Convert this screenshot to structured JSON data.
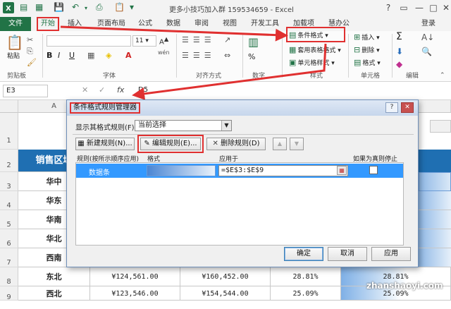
{
  "window": {
    "title": "更多小技巧加入群 159534659 - Excel",
    "user": "登录",
    "help": "?",
    "minimize": "—",
    "restore": "□",
    "close": "✕"
  },
  "ribbon_tabs": [
    "文件",
    "开始",
    "插入",
    "页面布局",
    "公式",
    "数据",
    "审阅",
    "视图",
    "开发工具",
    "加载项",
    "慧办公"
  ],
  "ribbon": {
    "clipboard": {
      "paste": "粘贴",
      "group_label": "剪贴板"
    },
    "font": {
      "font_name": "",
      "font_size": "11",
      "bold": "B",
      "italic": "I",
      "underline": "U",
      "group_label": "字体",
      "wen": "wén"
    },
    "alignment": {
      "group_label": "对齐方式"
    },
    "number": {
      "percent": "%",
      "group_label": "数字"
    },
    "styles": {
      "conditional_format": "条件格式",
      "table_format": "套用表格格式",
      "cell_styles": "单元格样式",
      "group_label": "样式"
    },
    "cells": {
      "insert": "插入",
      "delete": "删除",
      "format": "格式",
      "group_label": "单元格"
    },
    "editing": {
      "sum": "Σ",
      "group_label": "编辑"
    }
  },
  "formula_bar": {
    "name_box": "E3",
    "fx": "fx",
    "content": "D5"
  },
  "sheet": {
    "columns": [
      "A"
    ],
    "row_numbers": [
      "1",
      "2",
      "3",
      "4",
      "5",
      "6",
      "7",
      "8",
      "9"
    ],
    "header_a2": "销售区域",
    "regions": [
      "华中",
      "华东",
      "华南",
      "华北",
      "西南",
      "东北",
      "西北"
    ],
    "row8": {
      "c": "¥124,561.00",
      "d": "¥160,452.00",
      "e": "28.81%",
      "f": "28.81%"
    },
    "row9": {
      "c": "¥123,546.00",
      "d": "¥154,544.00",
      "e": "25.09%",
      "f": "25.09%"
    }
  },
  "dialog": {
    "title": "条件格式规则管理器",
    "show_rules_label": "显示其格式规则(F):",
    "show_rules_value": "当前选择",
    "new_rule": "新建规则(N)...",
    "edit_rule": "编辑规则(E)...",
    "delete_rule": "删除规则(D)",
    "move_up": "▲",
    "move_down": "▼",
    "columns": {
      "rule": "规则(按所示顺序应用)",
      "format": "格式",
      "applies_to": "应用于",
      "stop_if_true": "如果为真则停止"
    },
    "rules": [
      {
        "name": "数据条",
        "applies_to": "=$E$3:$E$9",
        "stop_if_true": false
      }
    ],
    "ok": "确定",
    "cancel": "取消",
    "apply": "应用"
  },
  "watermark": "zhanshaoyi.com",
  "colors": {
    "excel_green": "#217346",
    "highlight_red": "#e03030",
    "selection_blue": "#3399ff",
    "header_blue": "#1f6fb2"
  }
}
